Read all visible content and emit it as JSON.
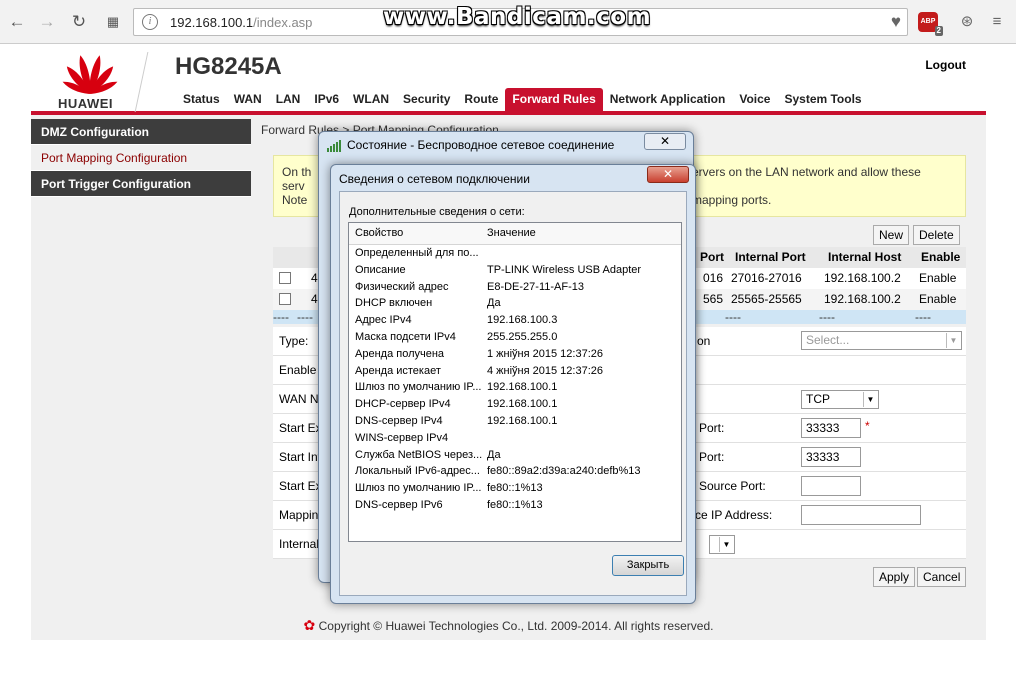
{
  "browser": {
    "url_host": "192.168.100.1",
    "url_path": "/index.asp",
    "abp_label": "ABP",
    "abp_count": "2"
  },
  "watermark": "www.Bandicam.com",
  "router": {
    "brand": "HUAWEI",
    "model": "HG8245A",
    "logout": "Logout",
    "nav": [
      "Status",
      "WAN",
      "LAN",
      "IPv6",
      "WLAN",
      "Security",
      "Route",
      "Forward Rules",
      "Network Application",
      "Voice",
      "System Tools"
    ],
    "active_nav": "Forward Rules",
    "sidebar": [
      "DMZ Configuration",
      "Port Mapping Configuration",
      "Port Trigger Configuration"
    ],
    "breadcrumb": "Forward Rules > Port Mapping Configuration",
    "note_line1_left": "On th",
    "note_line1_right": "ervers on the LAN network and allow these",
    "note_line2_left": "serv",
    "note_line3_left": "Note",
    "note_line3_right": "mapping ports.",
    "buttons": {
      "new": "New",
      "delete": "Delete",
      "apply": "Apply",
      "cancel": "Cancel"
    },
    "table": {
      "headers": [
        "Port",
        "Internal Port",
        "Internal Host",
        "Enable"
      ],
      "rows": [
        {
          "prefix": "4,",
          "port": "016",
          "internal_port": "27016-27016",
          "host": "192.168.100.2",
          "enable": "Enable"
        },
        {
          "prefix": "4,",
          "port": "565",
          "internal_port": "25565-25565",
          "host": "192.168.100.2",
          "enable": "Enable"
        }
      ],
      "dash": "----"
    },
    "form": {
      "type_label": "Type:",
      "enable_label": "Enable",
      "wan_label": "WAN N",
      "start_ext_label": "Start Ex",
      "start_int_label": "Start Int",
      "start_ext2_label": "Start Ex",
      "mapping_label": "Mappin",
      "internal_label": "Internal",
      "right_on": "on",
      "right_port1": "Port:",
      "right_port2": "Port:",
      "right_src_port": "Source Port:",
      "right_src_ip": "rce IP Address:",
      "select_placeholder": "Select...",
      "protocol": "TCP",
      "ext_port_value": "33333",
      "int_port_value": "33333",
      "required_mark": "*"
    },
    "copyright": "Copyright © Huawei Technologies Co., Ltd. 2009-2014. All rights reserved."
  },
  "dialog_status": {
    "title": "Состояние - Беспроводное сетевое соединение",
    "close": "✕"
  },
  "dialog_details": {
    "title": "Сведения о сетевом подключении",
    "close": "✕",
    "section_label": "Дополнительные сведения о сети:",
    "col_property": "Свойство",
    "col_value": "Значение",
    "rows": [
      {
        "p": "Определенный для по...",
        "v": ""
      },
      {
        "p": "Описание",
        "v": "TP-LINK Wireless USB Adapter"
      },
      {
        "p": "Физический адрес",
        "v": "E8-DE-27-11-AF-13"
      },
      {
        "p": "DHCP включен",
        "v": "Да"
      },
      {
        "p": "Адрес IPv4",
        "v": "192.168.100.3"
      },
      {
        "p": "Маска подсети IPv4",
        "v": "255.255.255.0"
      },
      {
        "p": "Аренда получена",
        "v": "1 жніўня 2015 12:37:26"
      },
      {
        "p": "Аренда истекает",
        "v": "4 жніўня 2015 12:37:26"
      },
      {
        "p": "Шлюз по умолчанию IP...",
        "v": "192.168.100.1"
      },
      {
        "p": "DHCP-сервер IPv4",
        "v": "192.168.100.1"
      },
      {
        "p": "DNS-сервер IPv4",
        "v": "192.168.100.1"
      },
      {
        "p": "WINS-сервер IPv4",
        "v": ""
      },
      {
        "p": "Служба NetBIOS через...",
        "v": "Да"
      },
      {
        "p": "Локальный IPv6-адрес...",
        "v": "fe80::89a2:d39a:a240:defb%13"
      },
      {
        "p": "Шлюз по умолчанию IP...",
        "v": "fe80::1%13"
      },
      {
        "p": "DNS-сервер IPv6",
        "v": "fe80::1%13"
      }
    ],
    "close_button": "Закрыть"
  }
}
